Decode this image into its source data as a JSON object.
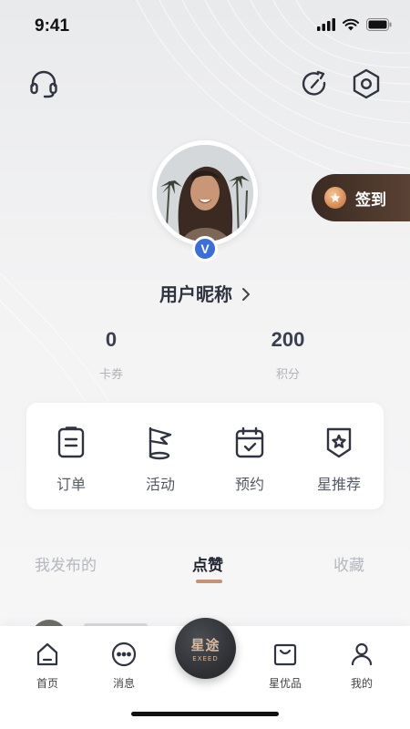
{
  "status_bar": {
    "time": "9:41"
  },
  "header": {
    "support_icon": "headset-icon",
    "refresh_icon": "refresh-icon",
    "settings_icon": "hexagon-settings-icon"
  },
  "profile": {
    "verified_badge": "V",
    "nickname": "用户昵称",
    "chevron": "›"
  },
  "signin": {
    "label": "签到"
  },
  "stats": [
    {
      "value": "0",
      "label": "卡券"
    },
    {
      "value": "200",
      "label": "积分"
    }
  ],
  "quick_actions": [
    {
      "label": "订单",
      "icon": "clipboard-icon"
    },
    {
      "label": "活动",
      "icon": "flag-icon"
    },
    {
      "label": "预约",
      "icon": "calendar-check-icon"
    },
    {
      "label": "星推荐",
      "icon": "star-badge-icon"
    }
  ],
  "content_tabs": {
    "items": [
      "我发布的",
      "点赞",
      "收藏"
    ],
    "active": "点赞"
  },
  "tab_bar": {
    "items": [
      {
        "label": "首页",
        "icon": "home-icon"
      },
      {
        "label": "消息",
        "icon": "message-dots-icon"
      },
      {
        "label": "星优品",
        "icon": "shopping-bag-icon"
      },
      {
        "label": "我的",
        "icon": "person-icon"
      }
    ],
    "center": {
      "title": "星途",
      "subtitle": "EXEED"
    }
  },
  "colors": {
    "accent": "#c59477",
    "signin_bg": "#3a2a22",
    "badge_blue": "#3a6fd8"
  }
}
